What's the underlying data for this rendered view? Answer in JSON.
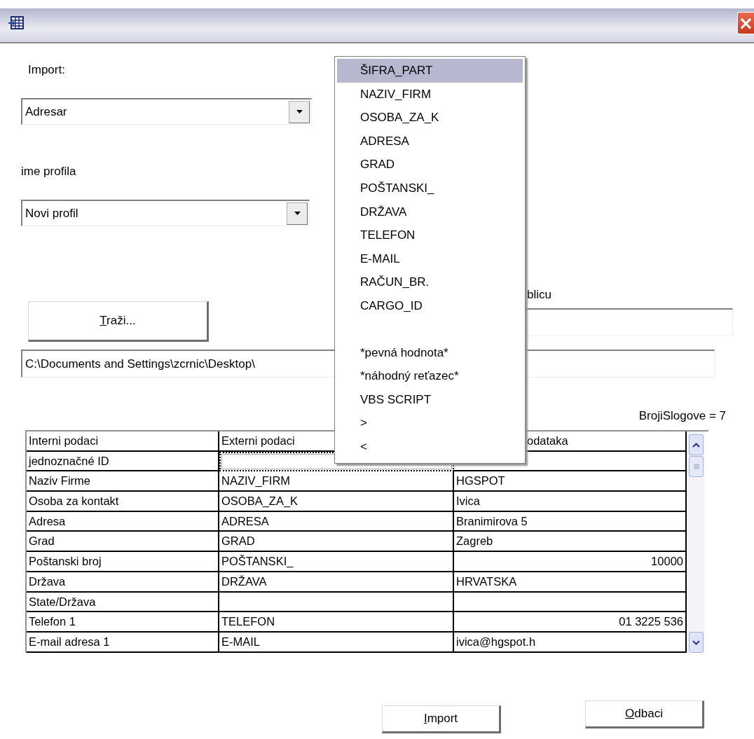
{
  "window": {
    "close": "×"
  },
  "import_label": "Import:",
  "import_combo": {
    "value": "Adresar"
  },
  "profile_label": "ime profila",
  "profile_combo": {
    "value": "Novi profil"
  },
  "browse_button": {
    "label": "Traži...",
    "mnemonic": true
  },
  "table_label": "blicu",
  "path_field": {
    "value": "C:\\Documents and Settings\\zcrnic\\Desktop\\"
  },
  "record_count": "BrojiSlogove = 7",
  "grid": {
    "columns": [
      "Interni podaci",
      "Externi podaci",
      "odataka"
    ],
    "rows": [
      {
        "cells": [
          {
            "kind": "text",
            "text": "jednoznačné ID",
            "focused": false
          },
          {
            "kind": "text",
            "focused": true
          },
          {
            "kind": "text",
            "focused": false
          }
        ]
      },
      {
        "cells": [
          {
            "kind": "text",
            "text": "Naziv Firme",
            "focused": false
          },
          {
            "kind": "text",
            "text": "NAZIV_FIRM",
            "focused": false
          },
          {
            "kind": "text",
            "text": "HGSPOT",
            "focused": false
          }
        ]
      },
      {
        "cells": [
          {
            "kind": "text",
            "text": "Osoba za kontakt",
            "focused": false
          },
          {
            "kind": "text",
            "text": "OSOBA_ZA_K",
            "focused": false
          },
          {
            "kind": "text",
            "text": "Ivica",
            "focused": false
          }
        ]
      },
      {
        "cells": [
          {
            "kind": "text",
            "text": "Adresa",
            "focused": false
          },
          {
            "kind": "text",
            "text": "ADRESA",
            "focused": false
          },
          {
            "kind": "text",
            "text": "Branimirova 5",
            "focused": false
          }
        ]
      },
      {
        "cells": [
          {
            "kind": "text",
            "text": "Grad",
            "focused": false
          },
          {
            "kind": "text",
            "text": "GRAD",
            "focused": false
          },
          {
            "kind": "text",
            "text": "Zagreb",
            "focused": false
          }
        ]
      },
      {
        "cells": [
          {
            "kind": "text",
            "text": "Poštanski broj",
            "focused": false
          },
          {
            "kind": "text",
            "text": "POŠTANSKI_",
            "focused": false
          },
          {
            "kind": "number",
            "text": "10000",
            "focused": false
          }
        ]
      },
      {
        "cells": [
          {
            "kind": "text",
            "text": "Država",
            "focused": false
          },
          {
            "kind": "text",
            "text": "DRŽAVA",
            "focused": false
          },
          {
            "kind": "text",
            "text": "HRVATSKA",
            "focused": false
          }
        ]
      },
      {
        "cells": [
          {
            "kind": "text",
            "text": "State/Država",
            "focused": false
          },
          {
            "kind": "text",
            "focused": false
          },
          {
            "kind": "text",
            "focused": false
          }
        ]
      },
      {
        "cells": [
          {
            "kind": "text",
            "text": "Telefon 1",
            "focused": false
          },
          {
            "kind": "text",
            "text": "TELEFON",
            "focused": false
          },
          {
            "kind": "number",
            "text": "01 3225 536",
            "focused": false
          }
        ]
      },
      {
        "cells": [
          {
            "kind": "text",
            "text": "E-mail adresa 1",
            "focused": false
          },
          {
            "kind": "text",
            "text": "E-MAIL",
            "focused": false
          },
          {
            "kind": "text",
            "text": "ivica@hgspot.h",
            "focused": false
          }
        ]
      }
    ]
  },
  "buttons": [
    {
      "label": "Import",
      "mnemonic": true
    },
    {
      "label": "Odbaci",
      "mnemonic": true
    }
  ],
  "field_menu": {
    "groups": [
      [
        {
          "label": "ŠIFRA_PART",
          "selected": true
        },
        {
          "label": "NAZIV_FIRM",
          "selected": false
        },
        {
          "label": "OSOBA_ZA_K",
          "selected": false
        },
        {
          "label": "ADRESA",
          "selected": false
        },
        {
          "label": "GRAD",
          "selected": false
        },
        {
          "label": "POŠTANSKI_",
          "selected": false
        },
        {
          "label": "DRŽAVA",
          "selected": false
        },
        {
          "label": "TELEFON",
          "selected": false
        },
        {
          "label": "E-MAIL",
          "selected": false
        },
        {
          "label": "RAČUN_BR.",
          "selected": false
        },
        {
          "label": "CARGO_ID",
          "selected": false
        }
      ],
      [
        {
          "label": "*pevná hodnota*",
          "selected": false
        },
        {
          "label": "*náhodný reťazec*",
          "selected": false
        },
        {
          "label": "VBS SCRIPT",
          "selected": false
        },
        {
          "label": ">",
          "selected": false
        },
        {
          "label": "<",
          "selected": false
        }
      ]
    ]
  }
}
